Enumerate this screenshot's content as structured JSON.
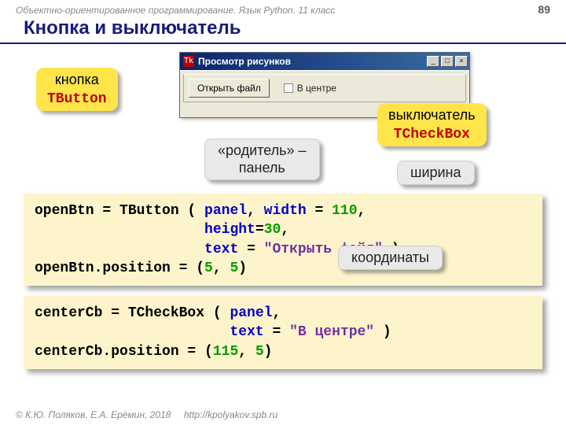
{
  "header": {
    "course": "Объектно-ориентированное программирование. Язык Python. 11 класс",
    "page": "89"
  },
  "title": "Кнопка и выключатель",
  "window": {
    "title": "Просмотр рисунков",
    "icon": "Tk",
    "minimize": "_",
    "maximize": "□",
    "close": "×",
    "button_label": "Открыть файл",
    "checkbox_label": "В центре"
  },
  "notes": {
    "button_word": "кнопка",
    "button_class": "TButton",
    "checkbox_word": "выключатель",
    "checkbox_class": "TCheckBox"
  },
  "callouts": {
    "parent_l1": "«родитель» –",
    "parent_l2": "панель",
    "width": "ширина",
    "coord": "координаты"
  },
  "code1": {
    "l1a": "openBtn = TButton ( ",
    "l1b": "panel",
    "l1c": ", ",
    "l1d": "width",
    "l1e": " = ",
    "l1f": "110",
    "l1g": ",",
    "l2a": "                    ",
    "l2b": "height",
    "l2c": "=",
    "l2d": "30",
    "l2e": ",",
    "l3a": "                    ",
    "l3b": "text",
    "l3c": " = ",
    "l3d": "\"Открыть файл\"",
    "l3e": " )",
    "l4a": "openBtn.position = (",
    "l4b": "5",
    "l4c": ", ",
    "l4d": "5",
    "l4e": ")"
  },
  "code2": {
    "l1a": "centerCb = TCheckBox ( ",
    "l1b": "panel",
    "l1c": ",",
    "l2a": "                       ",
    "l2b": "text",
    "l2c": " = ",
    "l2d": "\"В центре\"",
    "l2e": " )",
    "l3a": "centerCb.position = (",
    "l3b": "115",
    "l3c": ", ",
    "l3d": "5",
    "l3e": ")"
  },
  "footer": {
    "copy": "© К.Ю. Поляков, Е.А. Ерёмин, 2018",
    "url": "http://kpolyakov.spb.ru"
  }
}
